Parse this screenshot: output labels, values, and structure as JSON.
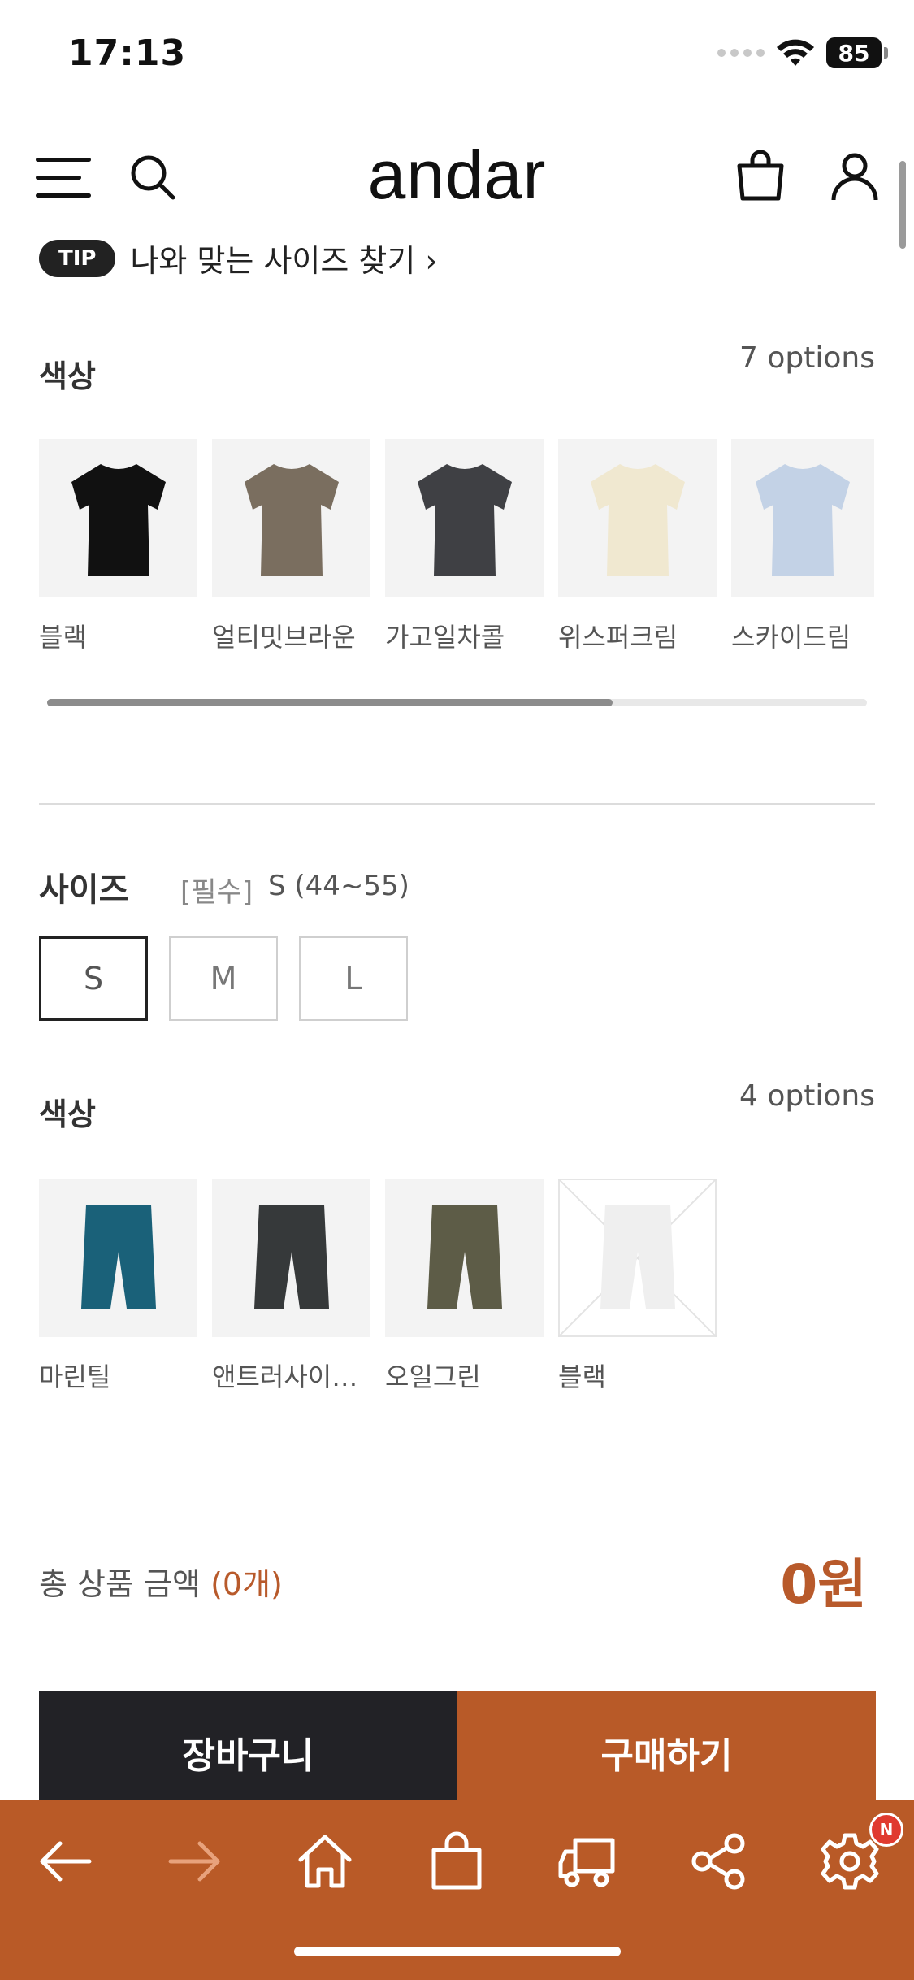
{
  "status_bar": {
    "time": "17:13",
    "battery": "85"
  },
  "header": {
    "brand": "andar"
  },
  "tip": {
    "badge": "TIP",
    "text": "나와 맞는 사이즈 찾기 ›"
  },
  "top_color": {
    "title": "색상",
    "count": "7 options",
    "items": [
      {
        "label": "블랙",
        "color": "#111111"
      },
      {
        "label": "얼티밋브라운",
        "color": "#7a6e5f"
      },
      {
        "label": "가고일차콜",
        "color": "#3f4044"
      },
      {
        "label": "위스퍼크림",
        "color": "#f0e8d0"
      },
      {
        "label": "스카이드림",
        "color": "#c3d2e6"
      }
    ],
    "scroll_fraction": 0.69
  },
  "size": {
    "title": "사이즈",
    "required": "[필수]",
    "selected": "S (44~55)",
    "options": [
      "S",
      "M",
      "L"
    ],
    "active": "S"
  },
  "bottom_color": {
    "title": "색상",
    "count": "4 options",
    "items": [
      {
        "label": "마린틸",
        "color": "#1a6179"
      },
      {
        "label": "앤트러사이트...",
        "color": "#36393a"
      },
      {
        "label": "오일그린",
        "color": "#5d5c47"
      },
      {
        "label": "블랙",
        "color": "#efefef"
      }
    ]
  },
  "total": {
    "label": "총 상품 금액",
    "count": "(0개)",
    "price": "0원"
  },
  "actions": {
    "cart": "장바구니",
    "buy": "구매하기"
  },
  "toolbar": {
    "icons": [
      "back-arrow-icon",
      "forward-arrow-icon",
      "home-icon",
      "shopping-bag-icon",
      "delivery-truck-icon",
      "share-icon",
      "settings-gear-icon"
    ],
    "badge": "N",
    "color": "#b95a27"
  }
}
